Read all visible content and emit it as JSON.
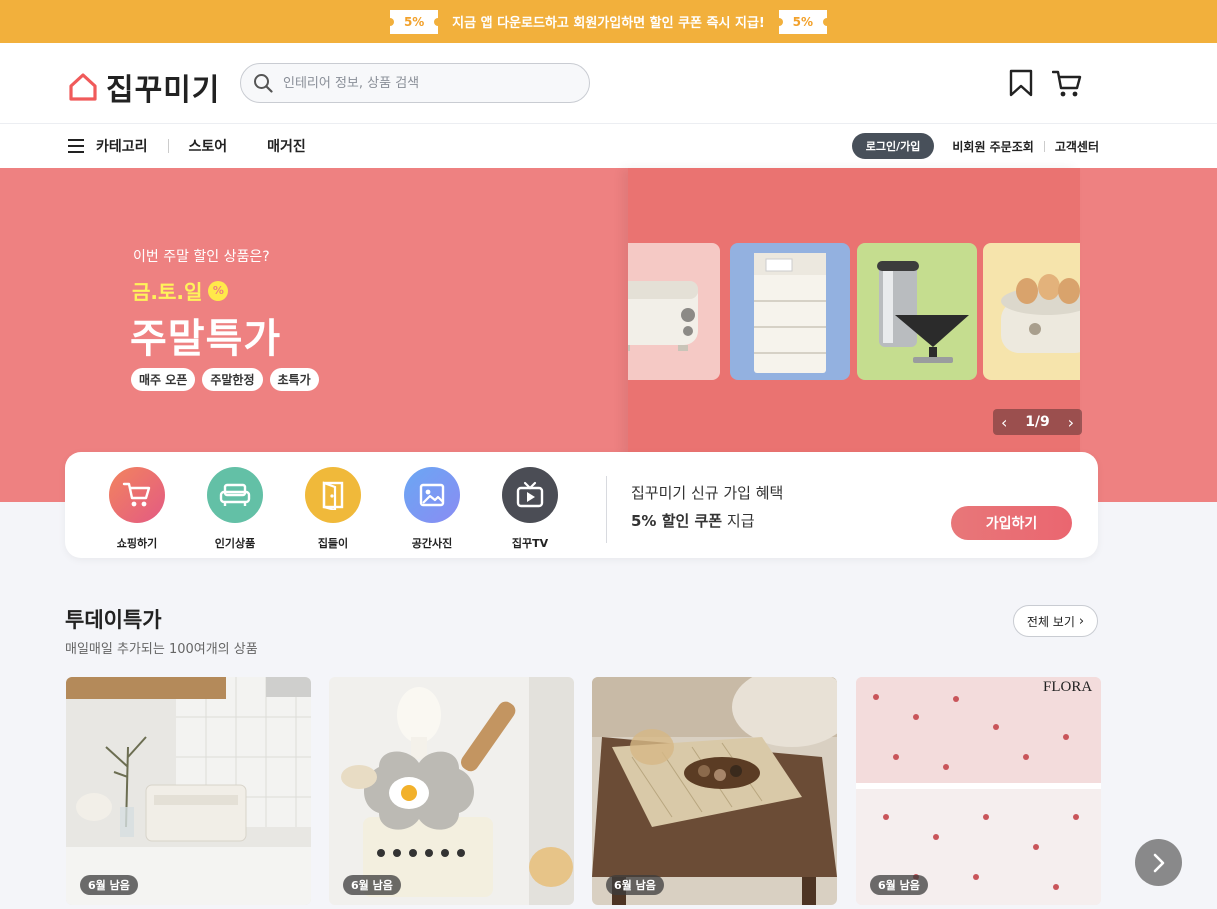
{
  "promo": {
    "left_badge": "5%",
    "text": "지금 앱 다운로드하고 회원가입하면 할인 쿠폰 즉시 지급!",
    "right_badge": "5%"
  },
  "header": {
    "logo_text": "집꾸미기",
    "search_placeholder": "인테리어 정보, 상품 검색",
    "icons": [
      "bookmark-icon",
      "cart-icon"
    ]
  },
  "nav": {
    "category": "카테고리",
    "store": "스토어",
    "magazine": "매거진",
    "login": "로그인/가입",
    "guest_order": "비회원 주문조회",
    "customer_center": "고객센터"
  },
  "hero": {
    "subtitle": "이번 주말 할인 상품은?",
    "days": "금.토.일",
    "pct_badge": "%",
    "title": "주말특가",
    "tags": [
      "매주 오픈",
      "주말한정",
      "초특가"
    ],
    "pager_current": "1",
    "pager_total": "9",
    "pager_text": "1/9",
    "colors": {
      "background": "#ee8181",
      "days": "#fff35a"
    }
  },
  "quick_menu": {
    "items": [
      {
        "label": "쇼핑하기",
        "icon": "cart-icon"
      },
      {
        "label": "인기상품",
        "icon": "sofa-icon"
      },
      {
        "label": "집들이",
        "icon": "door-icon"
      },
      {
        "label": "공간사진",
        "icon": "image-icon"
      },
      {
        "label": "집꾸TV",
        "icon": "tv-icon"
      }
    ],
    "join_line1": "집꾸미기 신규 가입 혜택",
    "join_line2_bold": "5% 할인 쿠폰",
    "join_line2_rest": " 지급",
    "join_button": "가입하기"
  },
  "today_deals": {
    "title": "투데이특가",
    "subtitle": "매일매일 추가되는 100여개의 상품",
    "see_all": "전체 보기",
    "cards": [
      {
        "badge": "6월 남음"
      },
      {
        "badge": "6월 남음"
      },
      {
        "badge": "6월 남음"
      },
      {
        "badge": "6월 남음",
        "brand": "FLORA"
      }
    ]
  }
}
